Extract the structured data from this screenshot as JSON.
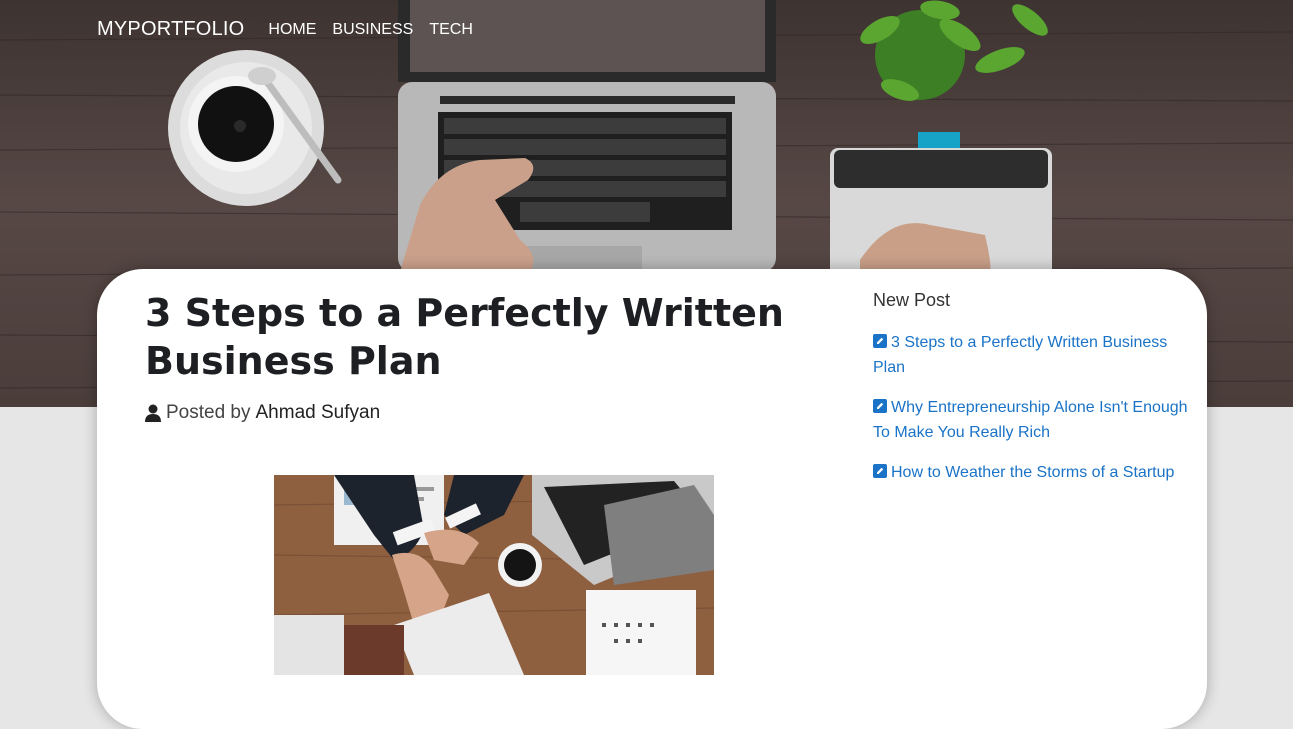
{
  "navbar": {
    "brand": "MYPORTFOLIO",
    "links": [
      "HOME",
      "BUSINESS",
      "TECH"
    ]
  },
  "post": {
    "title": "3 Steps to a Perfectly Written Business Plan",
    "posted_by_label": "Posted by",
    "author": "Ahmad Sufyan"
  },
  "sidebar": {
    "title": "New Post",
    "posts": [
      "3 Steps to a Perfectly Written Business Plan",
      "Why Entrepreneurship Alone Isn't Enough To Make You Really Rich",
      "How to Weather the Storms of a Startup"
    ]
  },
  "icons": {
    "author": "user-icon",
    "post_link": "edit-square-icon"
  },
  "colors": {
    "link": "#1a73c7",
    "title": "#1d1f22",
    "page_background": "#e6e6e6"
  }
}
